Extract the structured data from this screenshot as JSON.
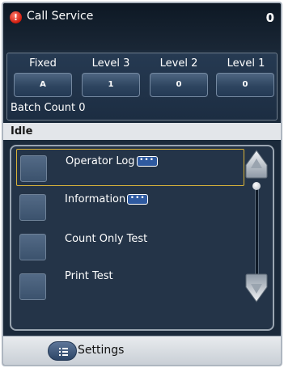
{
  "header": {
    "title": "Call Service",
    "count": "0",
    "alert_glyph": "!"
  },
  "levels": [
    {
      "label": "Fixed",
      "value": "A"
    },
    {
      "label": "Level 3",
      "value": "1"
    },
    {
      "label": "Level 2",
      "value": "0"
    },
    {
      "label": "Level 1",
      "value": "0"
    }
  ],
  "batch_count": "Batch Count 0",
  "status": "Idle",
  "menu": {
    "items": [
      {
        "label": "Operator Log",
        "has_more": true,
        "selected": true
      },
      {
        "label": "Information",
        "has_more": true,
        "selected": false
      },
      {
        "label": "Count Only Test",
        "has_more": false,
        "selected": false
      },
      {
        "label": "Print Test",
        "has_more": false,
        "selected": false
      }
    ],
    "more_glyph": "•••"
  },
  "footer": {
    "settings_label": "Settings"
  },
  "icons": {
    "alert": "alert-icon",
    "more": "more-icon",
    "scroll_up": "scroll-up-icon",
    "scroll_down": "scroll-down-icon",
    "settings": "settings-list-icon"
  },
  "colors": {
    "background": "#1b2a3b",
    "alert": "#d01b0d",
    "selection": "#d8b23a",
    "status_bar": "#e3e6ea"
  }
}
